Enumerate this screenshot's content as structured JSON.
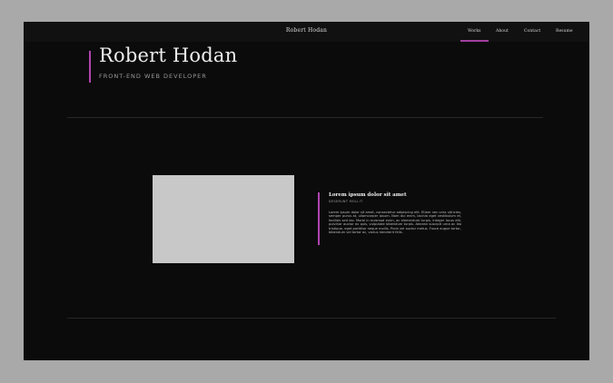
{
  "nav": {
    "brand": "Robert Hodan",
    "items": [
      {
        "label": "Works",
        "active": true
      },
      {
        "label": "About",
        "active": false
      },
      {
        "label": "Contact",
        "active": false
      },
      {
        "label": "Resume",
        "active": false
      }
    ]
  },
  "hero": {
    "name": "Robert Hodan",
    "role": "FRONT-END WEB DEVELOPER"
  },
  "project": {
    "title": "Lorem ipsum dolor sit amet",
    "subtitle": "DESERUNT MOLLIT",
    "description": "Lorem ipsum dolor sit amet, consectetur adipiscing elit. Etiam nec urna ultricies, semper purus at, ullamcorper ipsum. Nam dui enim, lacinia eget vestibulum et, facilisis sed leo. Morbi in euismod enim, ac elementum turpis. Integer lacus elit, pulvinar auctor ex quis, vulputate bibendum turpis. Aenean suscipit urna ac leo tristique, eget porttitor neque mollis. Proin vel auctor metus. Fusce augue tortor, bibendum vel tortor ac, varius hendrerit felis."
  },
  "colors": {
    "accent": "#b044b0",
    "background": "#0b0b0b",
    "navbar": "#111111",
    "image_placeholder": "#c8c8c8"
  }
}
